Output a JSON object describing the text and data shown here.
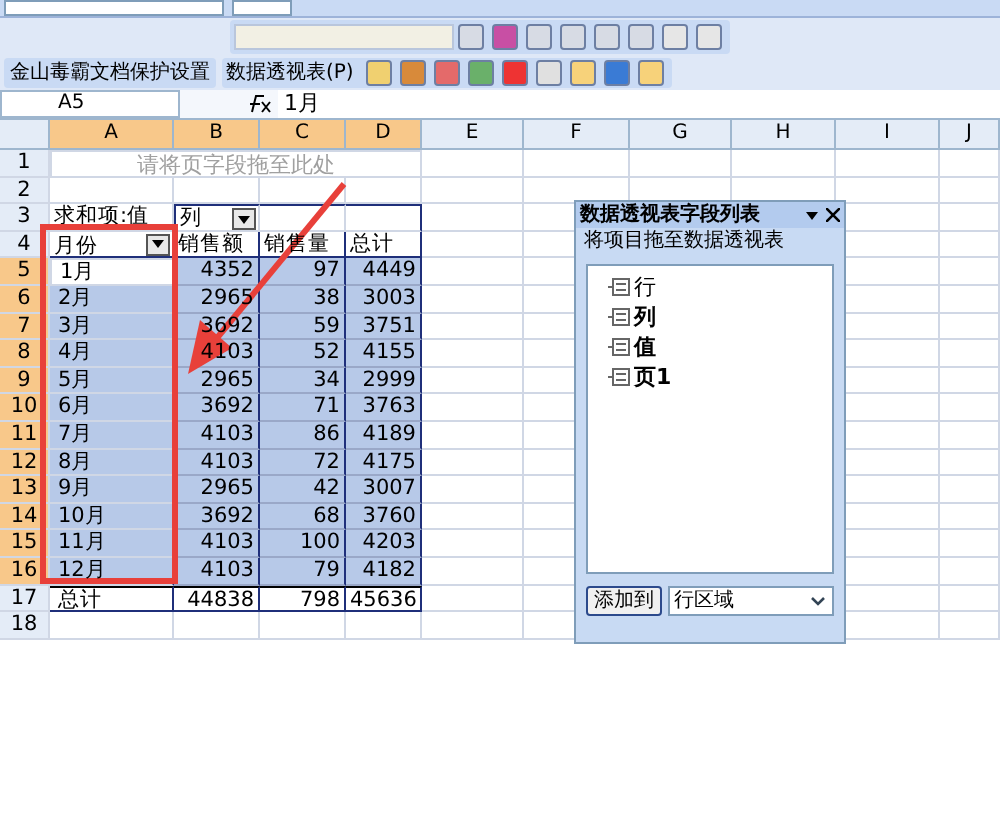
{
  "toolbar": {
    "protect_button": "金山毒霸文档保护设置",
    "pivot_menu": "数据透视表(P)"
  },
  "formula_bar": {
    "name_box": "A5",
    "formula": "1月"
  },
  "columns": [
    {
      "label": "A",
      "selected": true
    },
    {
      "label": "B",
      "selected": true
    },
    {
      "label": "C",
      "selected": true
    },
    {
      "label": "D",
      "selected": true
    },
    {
      "label": "E",
      "selected": false
    },
    {
      "label": "F",
      "selected": false
    },
    {
      "label": "G",
      "selected": false
    },
    {
      "label": "H",
      "selected": false
    },
    {
      "label": "I",
      "selected": false
    },
    {
      "label": "J",
      "selected": false
    }
  ],
  "row_numbers": [
    {
      "label": "1",
      "selected": false
    },
    {
      "label": "2",
      "selected": false
    },
    {
      "label": "3",
      "selected": false
    },
    {
      "label": "4",
      "selected": false
    },
    {
      "label": "5",
      "selected": true
    },
    {
      "label": "6",
      "selected": true
    },
    {
      "label": "7",
      "selected": true
    },
    {
      "label": "8",
      "selected": true
    },
    {
      "label": "9",
      "selected": true
    },
    {
      "label": "10",
      "selected": true
    },
    {
      "label": "11",
      "selected": true
    },
    {
      "label": "12",
      "selected": true
    },
    {
      "label": "13",
      "selected": true
    },
    {
      "label": "14",
      "selected": true
    },
    {
      "label": "15",
      "selected": true
    },
    {
      "label": "16",
      "selected": true
    },
    {
      "label": "17",
      "selected": false
    },
    {
      "label": "18",
      "selected": false
    }
  ],
  "pivot": {
    "page_hint": "请将页字段拖至此处",
    "data_label": "求和项:值",
    "column_field": "列",
    "row_field": "月份",
    "headers": [
      "销售额",
      "销售量",
      "总计"
    ],
    "rows": [
      {
        "label": "1月",
        "values": [
          "4352",
          "97",
          "4449"
        ],
        "selected": true,
        "active": true
      },
      {
        "label": "2月",
        "values": [
          "2965",
          "38",
          "3003"
        ],
        "selected": true,
        "active": false
      },
      {
        "label": "3月",
        "values": [
          "3692",
          "59",
          "3751"
        ],
        "selected": true,
        "active": false
      },
      {
        "label": "4月",
        "values": [
          "4103",
          "52",
          "4155"
        ],
        "selected": true,
        "active": false
      },
      {
        "label": "5月",
        "values": [
          "2965",
          "34",
          "2999"
        ],
        "selected": true,
        "active": false
      },
      {
        "label": "6月",
        "values": [
          "3692",
          "71",
          "3763"
        ],
        "selected": true,
        "active": false
      },
      {
        "label": "7月",
        "values": [
          "4103",
          "86",
          "4189"
        ],
        "selected": true,
        "active": false
      },
      {
        "label": "8月",
        "values": [
          "4103",
          "72",
          "4175"
        ],
        "selected": true,
        "active": false
      },
      {
        "label": "9月",
        "values": [
          "2965",
          "42",
          "3007"
        ],
        "selected": true,
        "active": false
      },
      {
        "label": "10月",
        "values": [
          "3692",
          "68",
          "3760"
        ],
        "selected": true,
        "active": false
      },
      {
        "label": "11月",
        "values": [
          "4103",
          "100",
          "4203"
        ],
        "selected": true,
        "active": false
      },
      {
        "label": "12月",
        "values": [
          "4103",
          "79",
          "4182"
        ],
        "selected": true,
        "active": false
      }
    ],
    "total": {
      "label": "总计",
      "values": [
        "44838",
        "798",
        "45636"
      ]
    }
  },
  "field_list": {
    "title": "数据透视表字段列表",
    "hint": "将项目拖至数据透视表",
    "items": [
      {
        "label": "行",
        "bold": false
      },
      {
        "label": "列",
        "bold": true
      },
      {
        "label": "值",
        "bold": true
      },
      {
        "label": "页1",
        "bold": true
      }
    ],
    "add_button": "添加到",
    "area": "行区域"
  }
}
